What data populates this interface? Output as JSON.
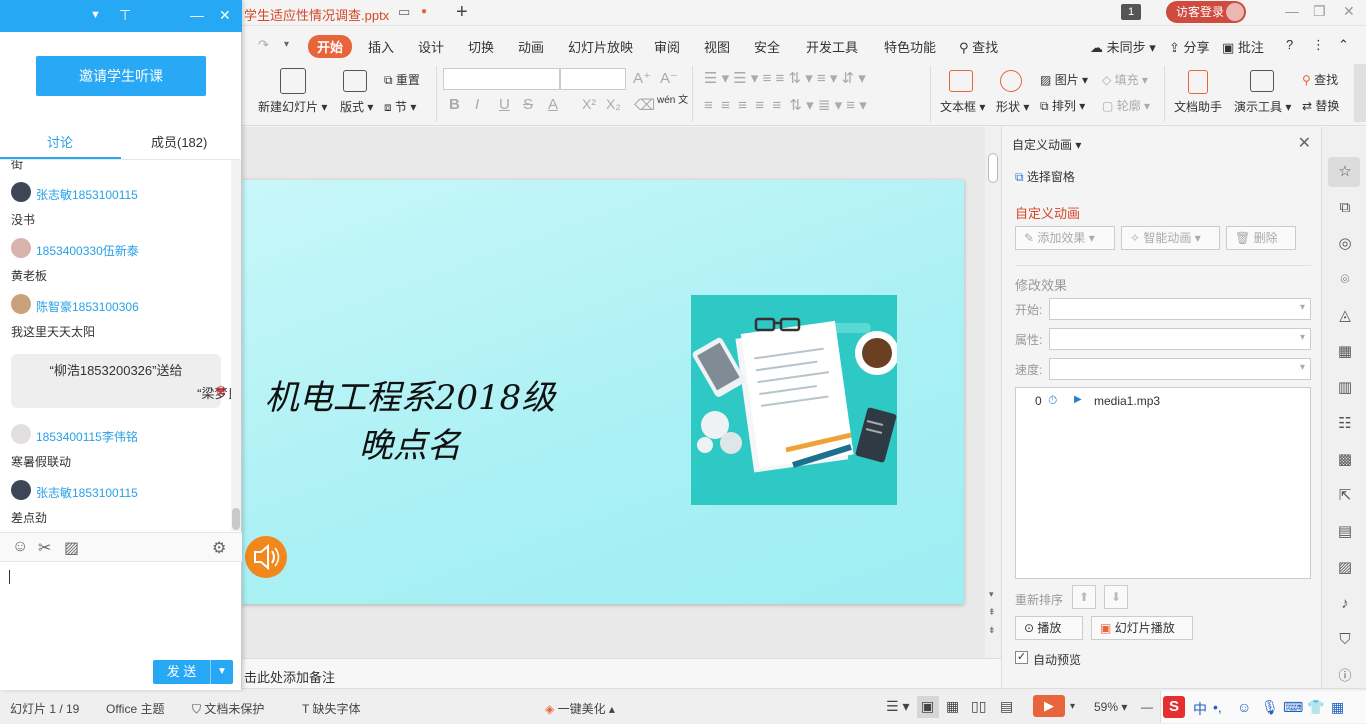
{
  "titlebar": {
    "doc_title": "学生适应性情况调查.pptx",
    "counter": "1",
    "login_label": "访客登录"
  },
  "menu": {
    "items": [
      "开始",
      "插入",
      "设计",
      "切换",
      "动画",
      "幻灯片放映",
      "审阅",
      "视图",
      "安全",
      "开发工具",
      "特色功能"
    ],
    "search_label": "查找",
    "sync_label": "未同步",
    "share_label": "分享",
    "comment_label": "批注",
    "help": "?"
  },
  "ribbon": {
    "new_slide": "新建幻灯片",
    "layout": "版式",
    "reset": "重置",
    "section": "节",
    "textbox": "文本框",
    "shape": "形状",
    "picture": "图片",
    "fill": "填充",
    "arrange": "排列",
    "outline": "轮廓",
    "doc_helper": "文档助手",
    "present_tools": "演示工具",
    "find": "查找",
    "replace": "替换",
    "pinyin": "wén 文"
  },
  "slide": {
    "title_line1": "机电工程系2018级",
    "title_line2": "晚点名"
  },
  "notes": {
    "placeholder": "击此处添加备注"
  },
  "anim_pane": {
    "header": "自定义动画",
    "select_pane": "选择窗格",
    "section_title": "自定义动画",
    "add_effect": "添加效果",
    "smart_anim": "智能动画",
    "delete": "删除",
    "modify_title": "修改效果",
    "start_label": "开始:",
    "property_label": "属性:",
    "speed_label": "速度:",
    "list": [
      {
        "index": "0",
        "name": "media1.mp3"
      }
    ],
    "reorder": "重新排序",
    "play": "播放",
    "slideshow": "幻灯片播放",
    "auto_preview": "自动预览"
  },
  "statusbar": {
    "slide_info": "幻灯片 1 / 19",
    "theme": "Office 主题",
    "protect": "文档未保护",
    "missing_font": "缺失字体",
    "beautify": "一键美化",
    "zoom": "59%",
    "ime": "中"
  },
  "chat": {
    "invite": "邀请学生听课",
    "tab_discuss": "讨论",
    "tab_members": "成员(182)",
    "top_partial": "街",
    "messages": [
      {
        "name": "张志敏1853100115",
        "text": "没书"
      },
      {
        "name": "1853400330伍新泰",
        "text": "黄老板"
      },
      {
        "name": "陈智豪1853100306",
        "text": "我这里天天太阳"
      }
    ],
    "gift_line1": "“柳浩1853200326”送给",
    "gift_line2": "“梁梦良”",
    "messages2": [
      {
        "name": "1853400115李伟铭",
        "text": "寒暑假联动"
      },
      {
        "name": "张志敏1853100115",
        "text": "差点劲"
      }
    ],
    "send": "发 送"
  }
}
